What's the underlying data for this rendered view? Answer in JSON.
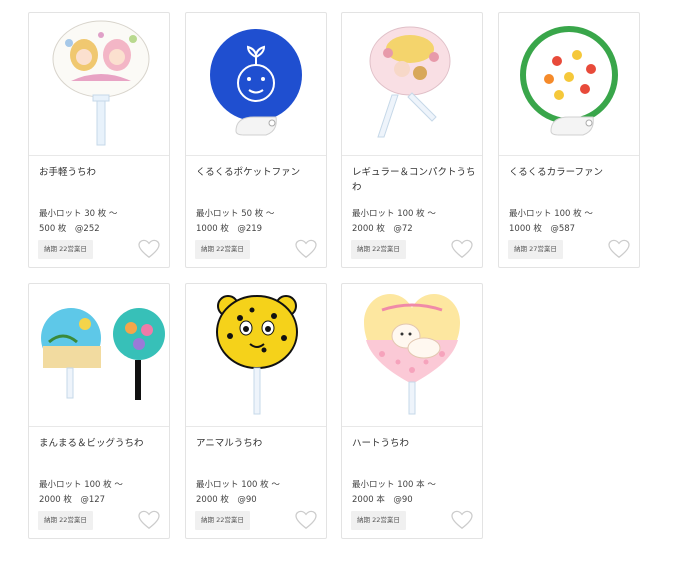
{
  "products": [
    {
      "title": "お手軽うちわ",
      "lot_line1": "最小ロット 30 枚 ～",
      "lot_line2": "500 枚　@252",
      "badge": "納期 22営業日",
      "image": "character-uchiwa-image"
    },
    {
      "title": "くるくるポケットファン",
      "lot_line1": "最小ロット 50 枚 ～",
      "lot_line2": "1000 枚　@219",
      "badge": "納期 22営業日",
      "image": "blue-pocket-fan-image"
    },
    {
      "title": "レギュラー＆コンパクトうちわ",
      "lot_line1": "最小ロット 100 枚 ～",
      "lot_line2": "2000 枚　@72",
      "badge": "納期 22営業日",
      "image": "regular-uchiwa-image"
    },
    {
      "title": "くるくるカラーファン",
      "lot_line1": "最小ロット 100 枚 ～",
      "lot_line2": "1000 枚　@587",
      "badge": "納期 27営業日",
      "image": "green-fruit-fan-image"
    },
    {
      "title": "まんまる＆ビッグうちわ",
      "lot_line1": "最小ロット 100 枚 ～",
      "lot_line2": "2000 枚　@127",
      "badge": "納期 22営業日",
      "image": "round-big-uchiwa-image"
    },
    {
      "title": "アニマルうちわ",
      "lot_line1": "最小ロット 100 枚 ～",
      "lot_line2": "2000 枚　@90",
      "badge": "納期 22営業日",
      "image": "leopard-uchiwa-image"
    },
    {
      "title": "ハートうちわ",
      "lot_line1": "最小ロット 100 本 ～",
      "lot_line2": "2000 本　@90",
      "badge": "納期 22営業日",
      "image": "heart-uchiwa-image"
    }
  ],
  "colors": {
    "heart_outline": "#cccccc",
    "badge_bg": "#f0f0f0",
    "border": "#e3e3e3"
  }
}
